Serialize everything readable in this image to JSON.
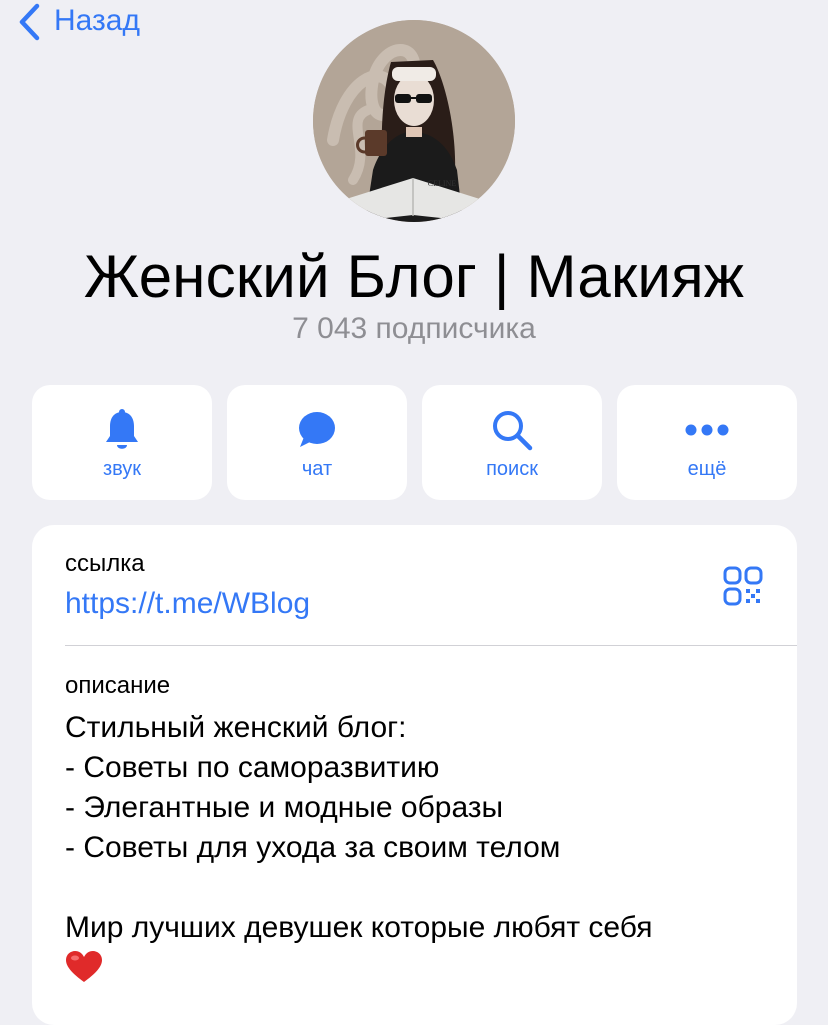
{
  "nav": {
    "back_label": "Назад",
    "accent_color": "#3478f6"
  },
  "channel": {
    "name": "Женский Блог | Макияж",
    "subscribers": "7 043 подписчика",
    "avatar_logo_text": "CELINE"
  },
  "actions": [
    {
      "label": "звук",
      "icon": "bell-icon"
    },
    {
      "label": "чат",
      "icon": "chat-bubble-icon"
    },
    {
      "label": "поиск",
      "icon": "search-icon"
    },
    {
      "label": "ещё",
      "icon": "more-dots-icon"
    }
  ],
  "info": {
    "link_label": "ссылка",
    "link_value": "https://t.me/WBlog",
    "qr_icon": "qr-code-icon",
    "description_label": "описание",
    "description_lines": [
      "Стильный женский блог:",
      "- Советы по саморазвитию",
      "- Элегантные и модные образы",
      "- Советы для ухода за своим телом"
    ],
    "description_footer": "Мир лучших девушек которые любят себя",
    "emoji": "heart-emoji"
  }
}
